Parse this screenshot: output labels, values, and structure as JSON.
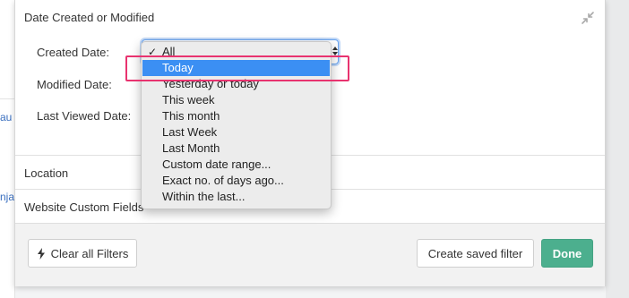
{
  "background": {
    "fragment_top": "au",
    "fragment_bottom": "nja"
  },
  "panel": {
    "section_title": "Date Created or Modified",
    "collapse_icon": "collapse-arrows-icon",
    "fields": {
      "created_label": "Created Date:",
      "modified_label": "Modified Date:",
      "last_viewed_label": "Last Viewed Date:"
    },
    "sections": {
      "location": "Location",
      "website_custom_fields": "Website Custom Fields"
    }
  },
  "dropdown": {
    "selected": "All",
    "check_mark": "✓",
    "options": [
      "All",
      "Today",
      "Yesterday or today",
      "This week",
      "This month",
      "Last Week",
      "Last Month",
      "Custom date range...",
      "Exact no. of days ago...",
      "Within the last..."
    ],
    "highlighted_index": 1
  },
  "footer": {
    "clear_label": "Clear all Filters",
    "clear_icon": "bolt-icon",
    "saved_filter_label": "Create saved filter",
    "done_label": "Done"
  },
  "colors": {
    "highlight": "#3b8ff3",
    "done_button": "#4caf8e",
    "annotation": "#e8336f"
  }
}
